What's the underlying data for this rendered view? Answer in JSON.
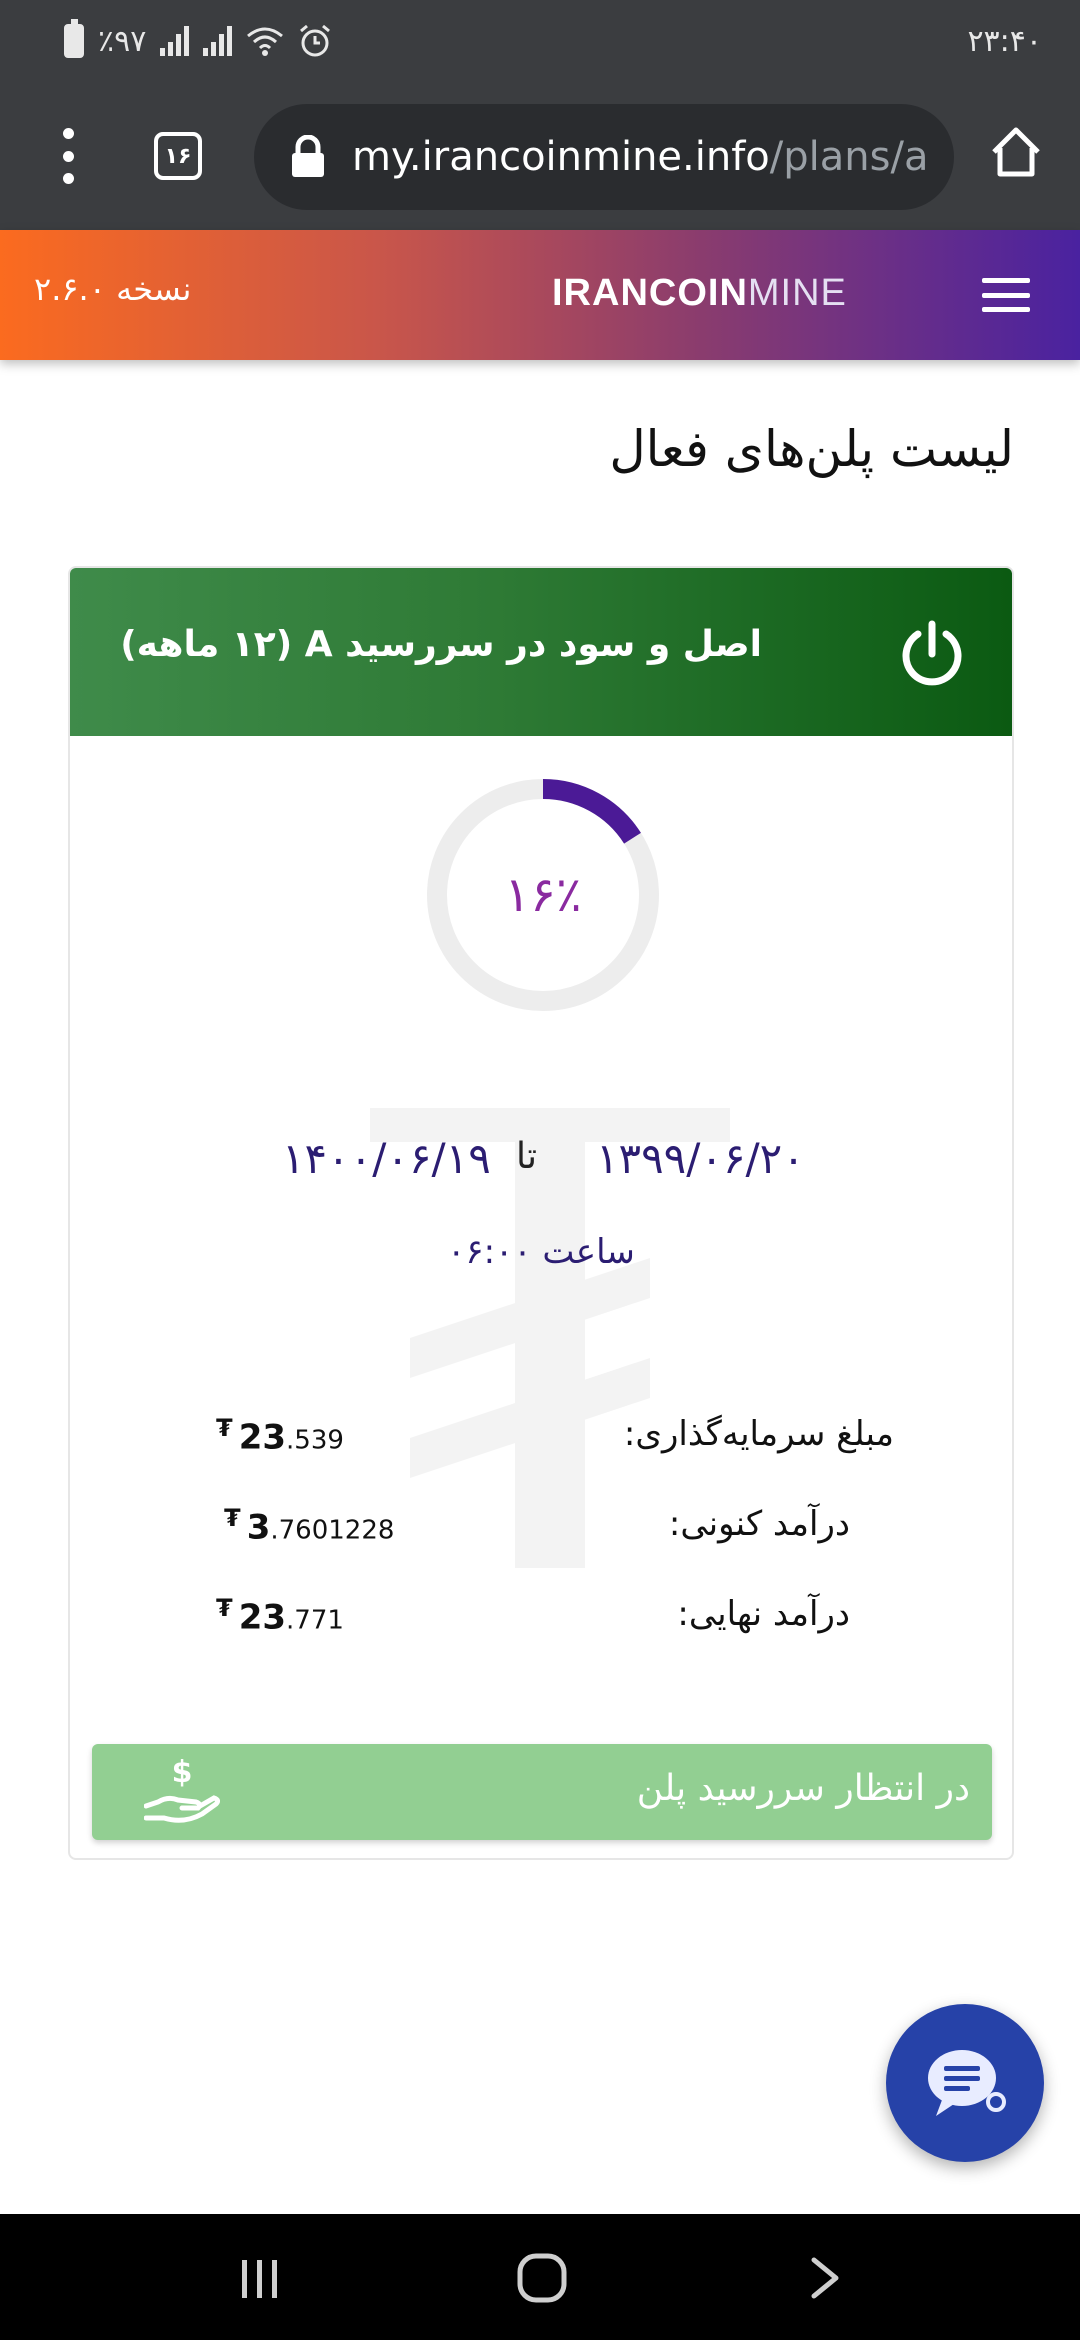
{
  "status_bar": {
    "battery": "٪۹۷",
    "time": "۲۳:۴۰"
  },
  "browser": {
    "tab_count": "۱۶",
    "url_host": "my.irancoinmine.info",
    "url_path": "/plans/a"
  },
  "site_header": {
    "logo_bold": "IRANCOIN",
    "logo_light": "MINE",
    "version": "نسخه ۲.۶.۰"
  },
  "page": {
    "title": "لیست پلن‌های فعال"
  },
  "plan": {
    "title": "اصل و سود در سررسید A (۱۲ ماهه)",
    "progress_label": "۱۶٪",
    "progress_fraction": 0.16,
    "start_date": "۱۳۹۹/۰۶/۲۰",
    "to_word": "تا",
    "end_date": "۱۴۰۰/۰۶/۱۹",
    "time": "ساعت ۰۶:۰۰",
    "currency_symbol": "₮",
    "rows": [
      {
        "label": "مبلغ سرمایه‌گذاری:",
        "int": "23",
        "frac": ".539"
      },
      {
        "label": "درآمد کنونی:",
        "int": "3",
        "frac": ".7601228"
      },
      {
        "label": "درآمد نهایی:",
        "int": "23",
        "frac": ".771"
      }
    ],
    "status_button": "در انتظار سررسید پلن"
  },
  "colors": {
    "header_start": "#fb6b1f",
    "header_end": "#4a22a0",
    "card_header": "#0b5a12",
    "progress": "#4b1a96",
    "status_button": "#92cf92",
    "chat_fab": "#2642a8"
  }
}
